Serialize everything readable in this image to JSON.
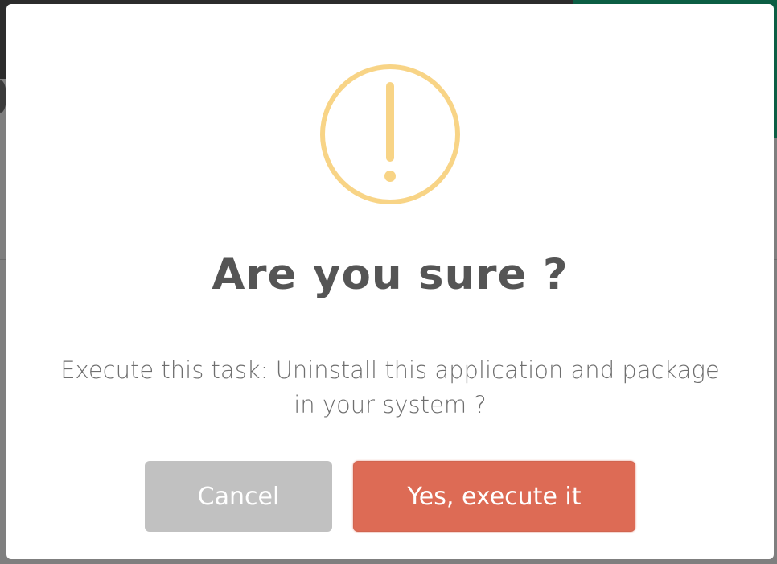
{
  "dialog": {
    "title": "Are you sure ?",
    "message": "Execute this task: Uninstall this application and package in your system ?",
    "cancel_label": "Cancel",
    "confirm_label": "Yes, execute it",
    "icon": "warning-icon"
  },
  "colors": {
    "warning": "#f8d486",
    "confirm": "#dd6b55",
    "cancel": "#c1c1c1",
    "title": "#555555",
    "overlay_accent": "#0c5e44"
  }
}
